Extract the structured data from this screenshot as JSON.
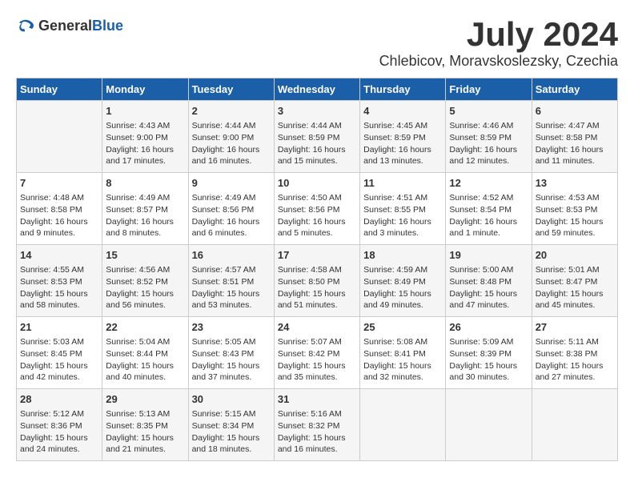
{
  "header": {
    "logo_general": "General",
    "logo_blue": "Blue",
    "month": "July 2024",
    "location": "Chlebicov, Moravskoslezsky, Czechia"
  },
  "days_of_week": [
    "Sunday",
    "Monday",
    "Tuesday",
    "Wednesday",
    "Thursday",
    "Friday",
    "Saturday"
  ],
  "weeks": [
    [
      {
        "day": "",
        "info": ""
      },
      {
        "day": "1",
        "info": "Sunrise: 4:43 AM\nSunset: 9:00 PM\nDaylight: 16 hours\nand 17 minutes."
      },
      {
        "day": "2",
        "info": "Sunrise: 4:44 AM\nSunset: 9:00 PM\nDaylight: 16 hours\nand 16 minutes."
      },
      {
        "day": "3",
        "info": "Sunrise: 4:44 AM\nSunset: 8:59 PM\nDaylight: 16 hours\nand 15 minutes."
      },
      {
        "day": "4",
        "info": "Sunrise: 4:45 AM\nSunset: 8:59 PM\nDaylight: 16 hours\nand 13 minutes."
      },
      {
        "day": "5",
        "info": "Sunrise: 4:46 AM\nSunset: 8:59 PM\nDaylight: 16 hours\nand 12 minutes."
      },
      {
        "day": "6",
        "info": "Sunrise: 4:47 AM\nSunset: 8:58 PM\nDaylight: 16 hours\nand 11 minutes."
      }
    ],
    [
      {
        "day": "7",
        "info": "Sunrise: 4:48 AM\nSunset: 8:58 PM\nDaylight: 16 hours\nand 9 minutes."
      },
      {
        "day": "8",
        "info": "Sunrise: 4:49 AM\nSunset: 8:57 PM\nDaylight: 16 hours\nand 8 minutes."
      },
      {
        "day": "9",
        "info": "Sunrise: 4:49 AM\nSunset: 8:56 PM\nDaylight: 16 hours\nand 6 minutes."
      },
      {
        "day": "10",
        "info": "Sunrise: 4:50 AM\nSunset: 8:56 PM\nDaylight: 16 hours\nand 5 minutes."
      },
      {
        "day": "11",
        "info": "Sunrise: 4:51 AM\nSunset: 8:55 PM\nDaylight: 16 hours\nand 3 minutes."
      },
      {
        "day": "12",
        "info": "Sunrise: 4:52 AM\nSunset: 8:54 PM\nDaylight: 16 hours\nand 1 minute."
      },
      {
        "day": "13",
        "info": "Sunrise: 4:53 AM\nSunset: 8:53 PM\nDaylight: 15 hours\nand 59 minutes."
      }
    ],
    [
      {
        "day": "14",
        "info": "Sunrise: 4:55 AM\nSunset: 8:53 PM\nDaylight: 15 hours\nand 58 minutes."
      },
      {
        "day": "15",
        "info": "Sunrise: 4:56 AM\nSunset: 8:52 PM\nDaylight: 15 hours\nand 56 minutes."
      },
      {
        "day": "16",
        "info": "Sunrise: 4:57 AM\nSunset: 8:51 PM\nDaylight: 15 hours\nand 53 minutes."
      },
      {
        "day": "17",
        "info": "Sunrise: 4:58 AM\nSunset: 8:50 PM\nDaylight: 15 hours\nand 51 minutes."
      },
      {
        "day": "18",
        "info": "Sunrise: 4:59 AM\nSunset: 8:49 PM\nDaylight: 15 hours\nand 49 minutes."
      },
      {
        "day": "19",
        "info": "Sunrise: 5:00 AM\nSunset: 8:48 PM\nDaylight: 15 hours\nand 47 minutes."
      },
      {
        "day": "20",
        "info": "Sunrise: 5:01 AM\nSunset: 8:47 PM\nDaylight: 15 hours\nand 45 minutes."
      }
    ],
    [
      {
        "day": "21",
        "info": "Sunrise: 5:03 AM\nSunset: 8:45 PM\nDaylight: 15 hours\nand 42 minutes."
      },
      {
        "day": "22",
        "info": "Sunrise: 5:04 AM\nSunset: 8:44 PM\nDaylight: 15 hours\nand 40 minutes."
      },
      {
        "day": "23",
        "info": "Sunrise: 5:05 AM\nSunset: 8:43 PM\nDaylight: 15 hours\nand 37 minutes."
      },
      {
        "day": "24",
        "info": "Sunrise: 5:07 AM\nSunset: 8:42 PM\nDaylight: 15 hours\nand 35 minutes."
      },
      {
        "day": "25",
        "info": "Sunrise: 5:08 AM\nSunset: 8:41 PM\nDaylight: 15 hours\nand 32 minutes."
      },
      {
        "day": "26",
        "info": "Sunrise: 5:09 AM\nSunset: 8:39 PM\nDaylight: 15 hours\nand 30 minutes."
      },
      {
        "day": "27",
        "info": "Sunrise: 5:11 AM\nSunset: 8:38 PM\nDaylight: 15 hours\nand 27 minutes."
      }
    ],
    [
      {
        "day": "28",
        "info": "Sunrise: 5:12 AM\nSunset: 8:36 PM\nDaylight: 15 hours\nand 24 minutes."
      },
      {
        "day": "29",
        "info": "Sunrise: 5:13 AM\nSunset: 8:35 PM\nDaylight: 15 hours\nand 21 minutes."
      },
      {
        "day": "30",
        "info": "Sunrise: 5:15 AM\nSunset: 8:34 PM\nDaylight: 15 hours\nand 18 minutes."
      },
      {
        "day": "31",
        "info": "Sunrise: 5:16 AM\nSunset: 8:32 PM\nDaylight: 15 hours\nand 16 minutes."
      },
      {
        "day": "",
        "info": ""
      },
      {
        "day": "",
        "info": ""
      },
      {
        "day": "",
        "info": ""
      }
    ]
  ]
}
